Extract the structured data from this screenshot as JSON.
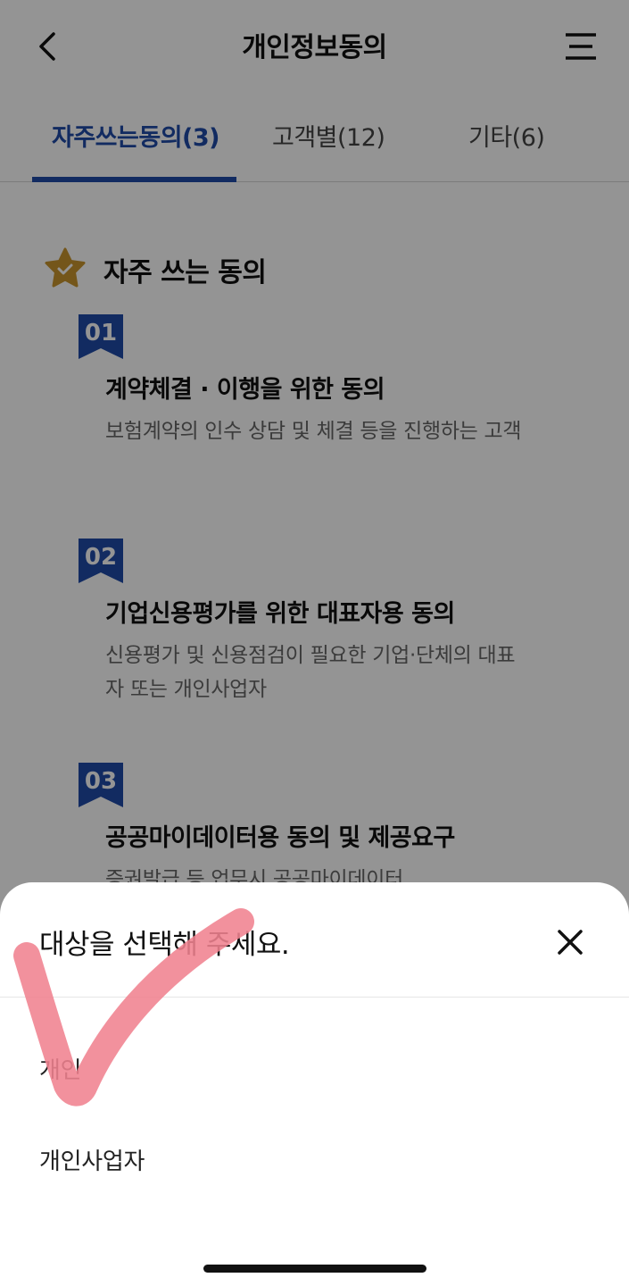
{
  "header": {
    "title": "개인정보동의",
    "back_icon": "chevron-left-icon",
    "menu_icon": "menu-icon"
  },
  "tabs": [
    {
      "label": "자주쓰는동의(3)",
      "active": true
    },
    {
      "label": "고객별(12)",
      "active": false
    },
    {
      "label": "기타(6)",
      "active": false
    }
  ],
  "section": {
    "title": "자주 쓰는 동의",
    "icon": "star-check-icon"
  },
  "cards": [
    {
      "number": "01",
      "title": "계약체결 · 이행을 위한 동의",
      "desc": "보험계약의 인수 상담 및 체결 등을 진행하는 고객"
    },
    {
      "number": "02",
      "title": "기업신용평가를 위한 대표자용 동의",
      "desc": "신용평가 및 신용점검이 필요한 기업·단체의 대표자 또는 개인사업자"
    },
    {
      "number": "03",
      "title": "공공마이데이터용 동의 및 제공요구",
      "desc": "증권발급 등 업무시 공공마이데이터"
    }
  ],
  "sheet": {
    "title": "대상을 선택해 주세요.",
    "close_icon": "close-icon",
    "options": [
      "개인",
      "개인사업자"
    ]
  },
  "colors": {
    "accent": "#1f4aa8",
    "star": "#c9952e",
    "annotation": "#f0828f"
  }
}
